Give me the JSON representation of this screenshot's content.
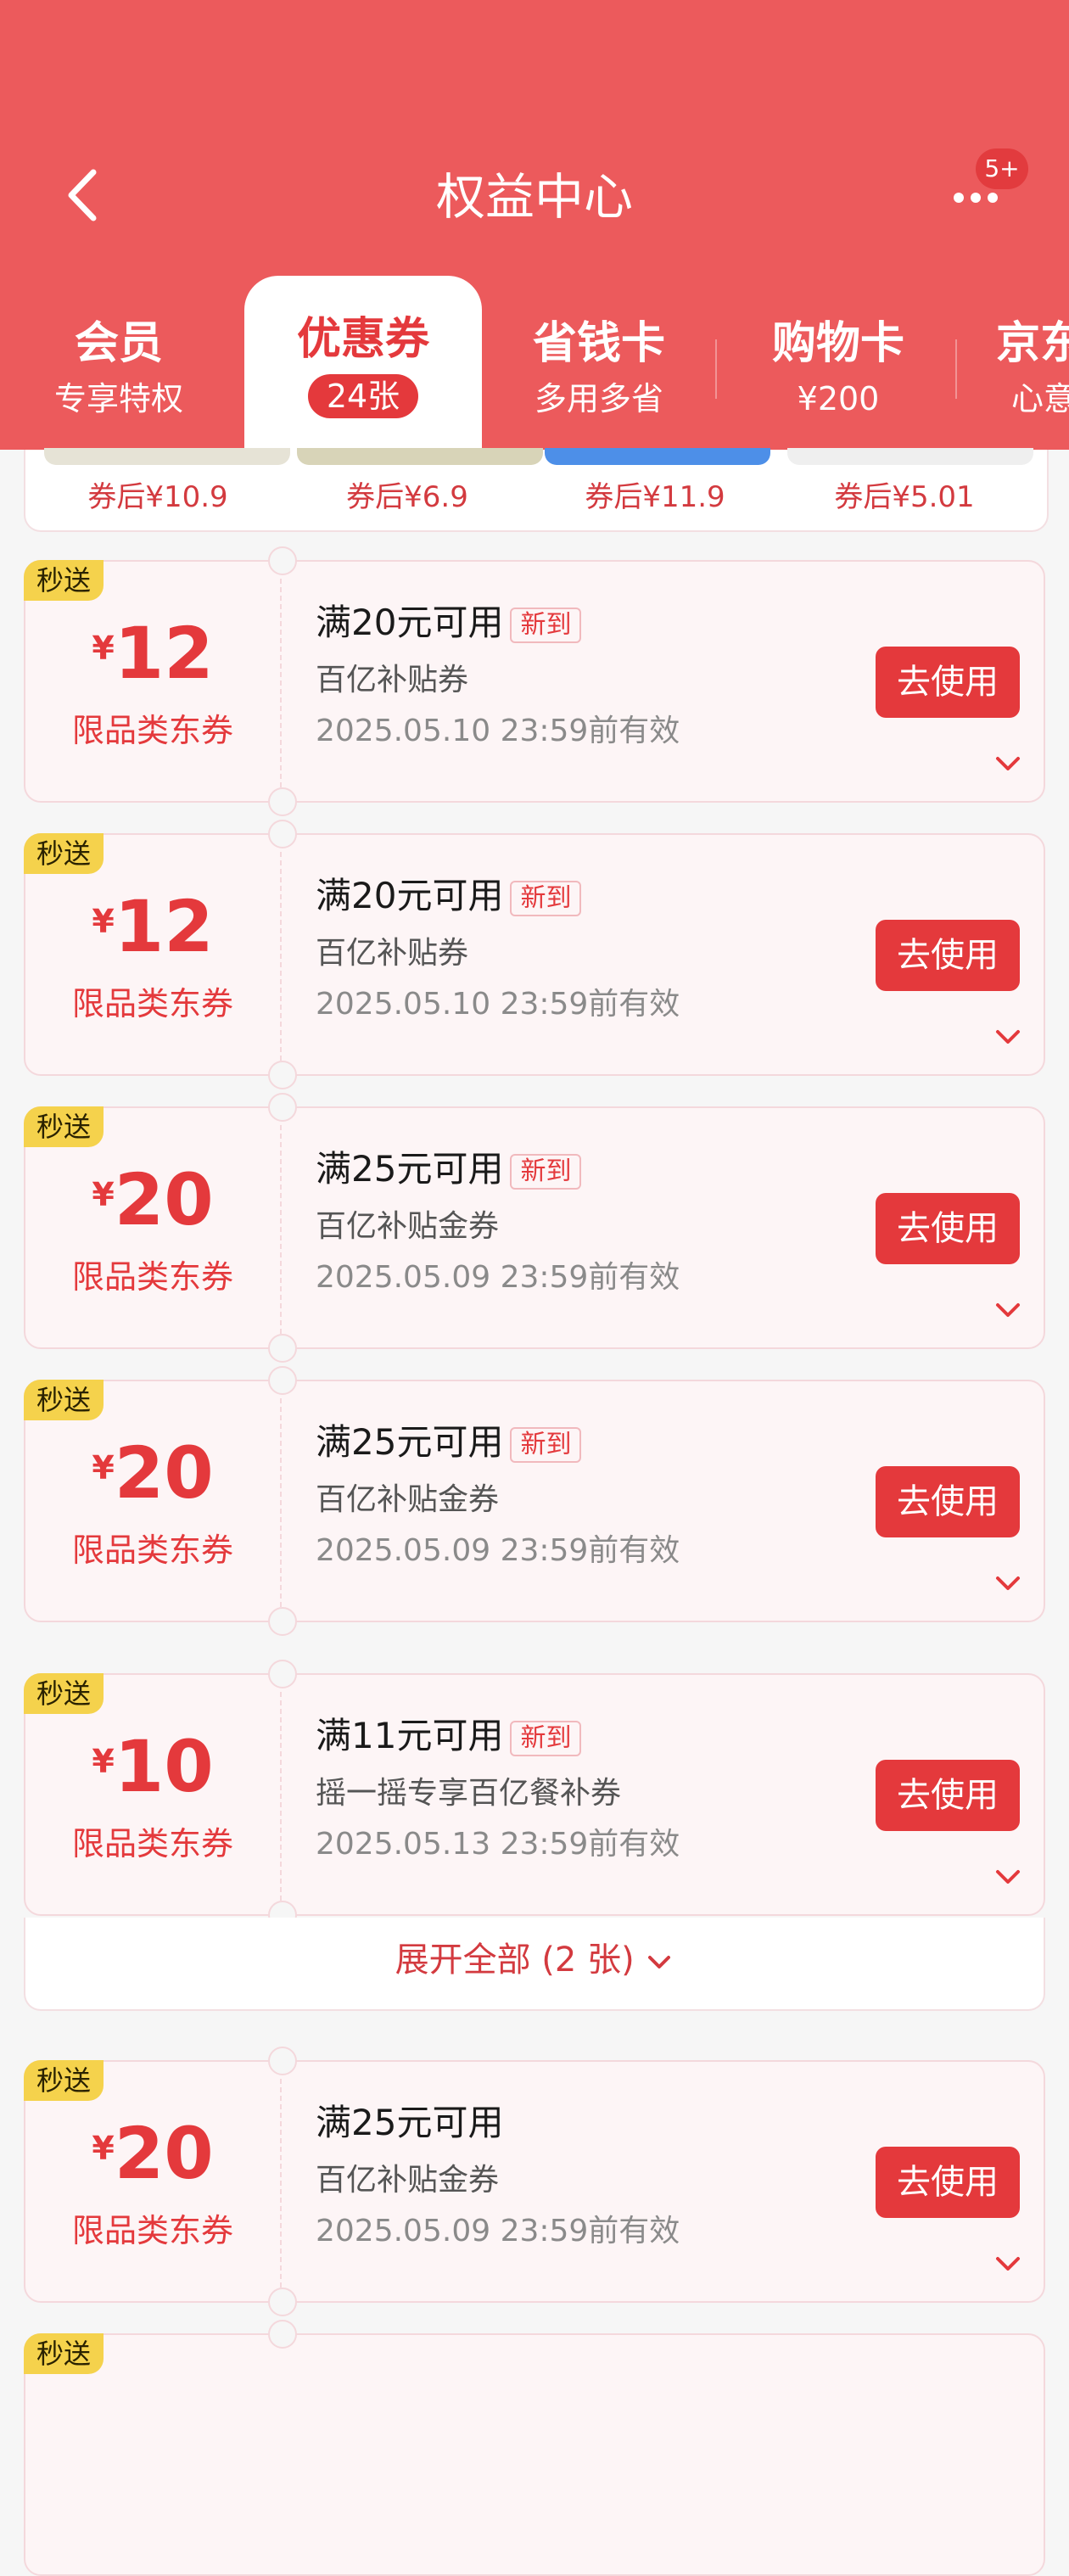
{
  "header": {
    "title": "权益中心",
    "more_badge": "5+",
    "tabs": [
      {
        "label": "会员",
        "sub": "专享特权"
      },
      {
        "label": "优惠券",
        "sub": "24张"
      },
      {
        "label": "省钱卡",
        "sub": "多用多省"
      },
      {
        "label": "购物卡",
        "sub": "¥200"
      },
      {
        "label": "京东",
        "sub": "心意"
      }
    ]
  },
  "strip": {
    "prices": [
      "券后¥10.9",
      "券后¥6.9",
      "券后¥11.9",
      "券后¥5.01"
    ]
  },
  "coupons": [
    {
      "tag": "秒送",
      "yen": "¥",
      "amount": "12",
      "category": "限品类东券",
      "condition": "满20元可用",
      "new": "新到",
      "name": "百亿补贴券",
      "expiry": "2025.05.10 23:59前有效",
      "action": "去使用"
    },
    {
      "tag": "秒送",
      "yen": "¥",
      "amount": "12",
      "category": "限品类东券",
      "condition": "满20元可用",
      "new": "新到",
      "name": "百亿补贴券",
      "expiry": "2025.05.10 23:59前有效",
      "action": "去使用"
    },
    {
      "tag": "秒送",
      "yen": "¥",
      "amount": "20",
      "category": "限品类东券",
      "condition": "满25元可用",
      "new": "新到",
      "name": "百亿补贴金券",
      "expiry": "2025.05.09 23:59前有效",
      "action": "去使用"
    },
    {
      "tag": "秒送",
      "yen": "¥",
      "amount": "20",
      "category": "限品类东券",
      "condition": "满25元可用",
      "new": "新到",
      "name": "百亿补贴金券",
      "expiry": "2025.05.09 23:59前有效",
      "action": "去使用"
    },
    {
      "tag": "秒送",
      "yen": "¥",
      "amount": "10",
      "category": "限品类东券",
      "condition": "满11元可用",
      "new": "新到",
      "name": "摇一摇专享百亿餐补券",
      "expiry": "2025.05.13 23:59前有效",
      "action": "去使用"
    },
    {
      "tag": "秒送",
      "yen": "¥",
      "amount": "20",
      "category": "限品类东券",
      "condition": "满25元可用",
      "new": "",
      "name": "百亿补贴金券",
      "expiry": "2025.05.09 23:59前有效",
      "action": "去使用"
    },
    {
      "tag": "秒送"
    }
  ],
  "expand_label": "展开全部 (2 张)",
  "colors": {
    "header": "#ec5a5c",
    "accent": "#e4393c",
    "tag": "#f5d24c"
  },
  "icons": [
    "back-arrow-icon",
    "more-dots-icon",
    "chevron-down-icon"
  ]
}
